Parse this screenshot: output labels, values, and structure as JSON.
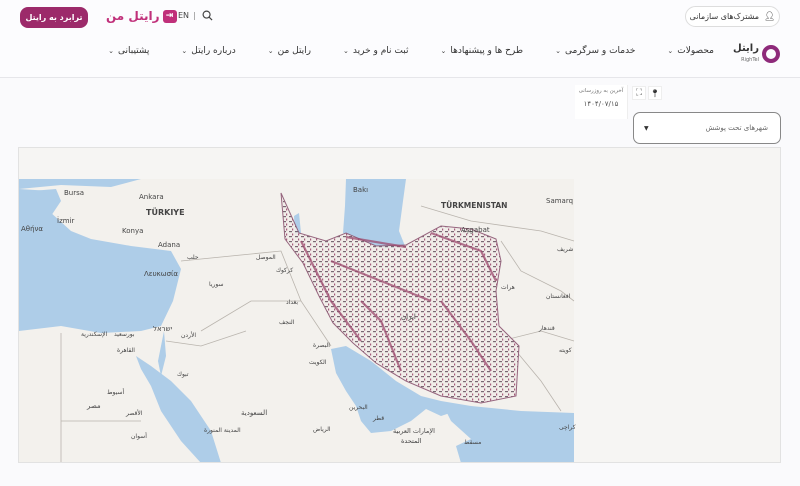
{
  "header": {
    "transfer_button": "ترابرد به رایتل",
    "my_logo": "رایتل من",
    "lang": "EN",
    "lang_sep": "|",
    "enterprise_button": "مشترک‌های سازمانی",
    "brand_fa": "رایتل",
    "brand_en": "RighTel",
    "nav": [
      {
        "label": "محصولات"
      },
      {
        "label": "خدمات و سرگرمی"
      },
      {
        "label": "طرح ها و پیشنهادها"
      },
      {
        "label": "ثبت نام و خرید"
      },
      {
        "label": "رایتل من"
      },
      {
        "label": "درباره رایتل"
      },
      {
        "label": "پشتیبانی"
      }
    ]
  },
  "controls": {
    "last_update_label": "آخرین به روزرسانی",
    "last_update_value": "۱۴۰۴/۰۷/۱۵",
    "city_select": "شهرهای تحت پوشش"
  },
  "map": {
    "coverage_color": "#9c4a6e",
    "labels": {
      "bursa": "Bursa",
      "ankara": "Ankara",
      "turkiye": "TÜRKIYE",
      "izmir": "İzmir",
      "athina": "Αθήνα",
      "konya": "Konya",
      "adana": "Adana",
      "lefkosia": "Λευκωσία",
      "halab": "حلب",
      "suriya": "سوريا",
      "mosul": "الموصل",
      "kirkuk": "كركوك",
      "baghdad": "بغداد",
      "najaf": "النجف",
      "baki": "Bakı",
      "turkmenistan": "TÜRKMENISTAN",
      "ashgabat": "Aşgabat",
      "samarq": "Samarq",
      "sharif": "شریف",
      "herat": "هرات",
      "afghanistan": "افغانستان",
      "iran": "ایران",
      "alexandria": "الإسكندرية",
      "portsaid": "بورسعيد",
      "israel": "ישראל",
      "jordan": "الأردن",
      "cairo": "القاهرة",
      "tabuk": "تبوك",
      "asyut": "أسيوط",
      "misr": "مصر",
      "luxor": "الأقصر",
      "saudi": "السعودية",
      "madina": "المدينة المنورة",
      "aswan": "أسوان",
      "kandahar": "قندهار",
      "quetta": "کویته",
      "kuwait": "الكويت",
      "basra": "البصرة",
      "bahrain": "البحرين",
      "qatar": "قطر",
      "riyadh": "الرياض",
      "uae1": "الإمارات العربية",
      "uae2": "المتحدة",
      "muscat": "مسقط",
      "karachi": "کراچی"
    }
  }
}
